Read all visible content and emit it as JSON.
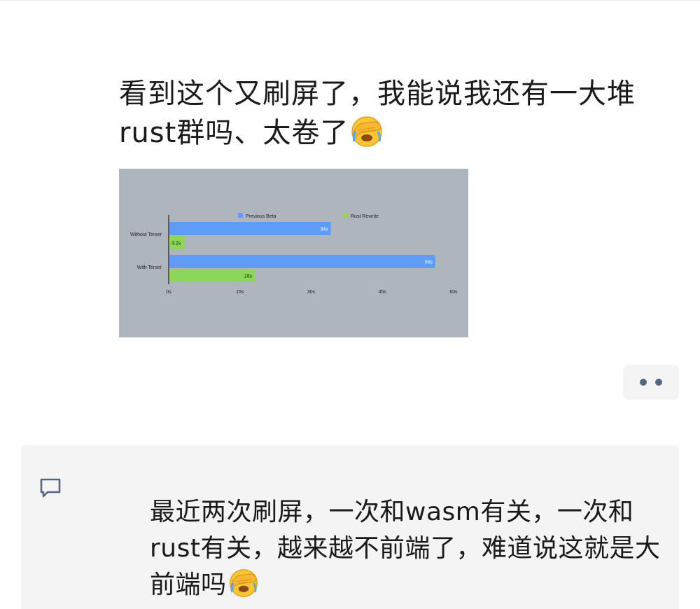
{
  "post": {
    "text": "看到这个又刷屏了，我能说我还有一大堆rust群吗、太卷了",
    "emoji": "facepalm-crying-emoji"
  },
  "chart_data": {
    "type": "bar",
    "orientation": "horizontal",
    "categories": [
      "Without Terser",
      "With Terser"
    ],
    "series": [
      {
        "name": "Previous Beta",
        "values": [
          34,
          56
        ],
        "value_labels": [
          "34s",
          "56s"
        ],
        "color": "#5e9cf5"
      },
      {
        "name": "Rust Rewrite",
        "values": [
          3.2,
          18
        ],
        "value_labels": [
          "3.2s",
          "18s"
        ],
        "color": "#8ed65a"
      }
    ],
    "x_ticks": [
      "0s",
      "15s",
      "30s",
      "45s",
      "60s"
    ],
    "xlim": [
      0,
      60
    ],
    "legend_position": "top",
    "grid": false,
    "background": "#aeb5bd"
  },
  "actions": {
    "more_icon": "more-dots-icon",
    "dot_color": "#56657e"
  },
  "comment": {
    "icon": "comment-icon",
    "text": "最近两次刷屏，一次和wasm有关，一次和rust有关，越来越不前端了，难道说这就是大前端吗",
    "emoji": "facepalm-crying-emoji"
  }
}
